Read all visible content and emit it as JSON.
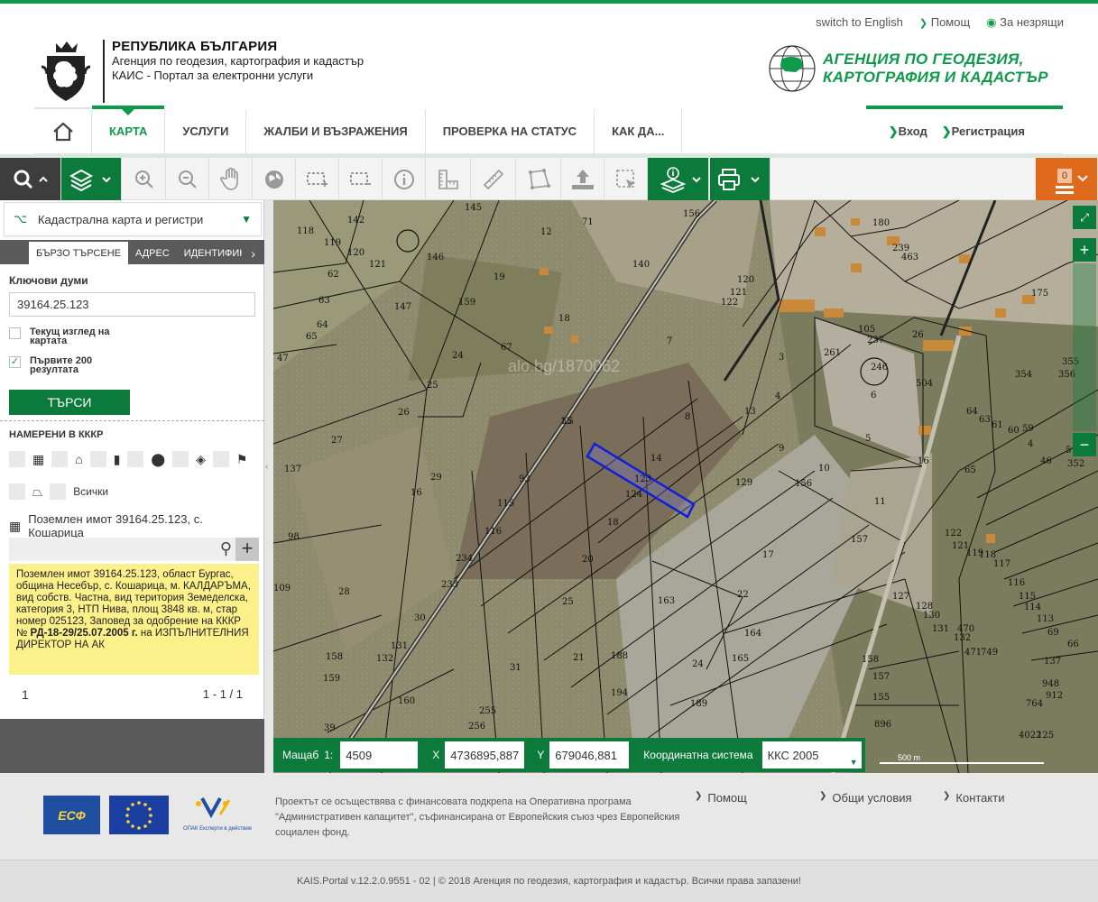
{
  "header": {
    "links": [
      "switch to English",
      "Помощ",
      "За незрящи"
    ],
    "org_line1": "РЕПУБЛИКА БЪЛГАРИЯ",
    "org_line2": "Агенция по геодезия, картография и кадастър",
    "org_line3": "КАИС - Портал за електронни услуги",
    "agency_line1": "АГЕНЦИЯ ПО ГЕОДЕЗИЯ,",
    "agency_line2": "КАРТОГРАФИЯ И КАДАСТЪР"
  },
  "nav": {
    "items": [
      "КАРТА",
      "УСЛУГИ",
      "ЖАЛБИ И ВЪЗРАЖЕНИЯ",
      "ПРОВЕРКА НА СТАТУС",
      "КАК ДА..."
    ],
    "active": "КАРТА",
    "login": "Вход",
    "register": "Регистрация"
  },
  "toolbar": {
    "cart_count": "0",
    "accent": "#0c7a3b",
    "orange": "#e06a1b"
  },
  "sidebar": {
    "layer": "Кадастрална карта и регистри",
    "tabs": [
      "БЪРЗО ТЪРСЕНЕ",
      "АДРЕС",
      "ИДЕНТИФИКА"
    ],
    "keywords_label": "Ключови думи",
    "keywords_value": "39164.25.123",
    "chk_current_view": "Текущ изглед на картата",
    "chk_first_200": "Първите 200 резултата",
    "chk_first_200_checked": "✓",
    "search_button": "ТЪРСИ",
    "found_label": "НАМЕРЕНИ В КККР",
    "filter_all": "Всички",
    "result_title": "Поземлен имот 39164.25.123, с. Кошарица",
    "info_text": "Поземлен имот 39164.25.123, област Бургас, община Несебър, с. Кошарица, м. КАЛДАРЪМА, вид собств. Частна, вид територия Земеделска, категория 3, НТП Нива, площ 3848 кв. м, стар номер 025123, Заповед за одобрение на КККР №",
    "info_bold": "РД-18-29/25.07.2005 г.",
    "info_tail": " на ИЗПЪЛНИТЕЛНИЯ ДИРЕКТОР НА АК",
    "page_current": "1",
    "page_range": "1 - 1 / 1"
  },
  "map": {
    "watermark": "alo.bg/1870062",
    "scale_label": "Мащаб",
    "scale_prefix": "1:",
    "scale_value": "4509",
    "x_label": "X",
    "x_value": "4736895,887",
    "y_label": "Y",
    "y_value": "679046,881",
    "crs_label": "Координатна система",
    "crs_value": "ККС 2005",
    "scalebar_label": "500 m",
    "parcel_labels": [
      "142",
      "118",
      "119",
      "120",
      "121",
      "62",
      "63",
      "64",
      "65",
      "147",
      "47",
      "27",
      "137",
      "98",
      "109",
      "28",
      "158",
      "159",
      "39",
      "145",
      "12",
      "71",
      "146",
      "19",
      "159",
      "18",
      "140",
      "156",
      "15",
      "67",
      "24",
      "25",
      "26",
      "29",
      "16",
      "30",
      "131",
      "132",
      "160",
      "93",
      "115",
      "116",
      "234",
      "233",
      "31",
      "255",
      "256",
      "15",
      "14",
      "123",
      "124",
      "18",
      "20",
      "25",
      "21",
      "188",
      "194",
      "8",
      "7",
      "129",
      "17",
      "163",
      "22",
      "164",
      "165",
      "24",
      "189",
      "121",
      "120",
      "122",
      "3",
      "4",
      "9",
      "10",
      "11",
      "156",
      "157",
      "6",
      "5",
      "16",
      "13",
      "158",
      "157",
      "155",
      "896",
      "4022",
      "125",
      "127",
      "128",
      "130",
      "131",
      "132",
      "470",
      "471",
      "749",
      "137",
      "764",
      "948",
      "912",
      "122",
      "121",
      "119",
      "118",
      "117",
      "116",
      "115",
      "114",
      "113",
      "69",
      "66",
      "65",
      "64",
      "63",
      "61",
      "60",
      "59",
      "4",
      "46",
      "5",
      "352",
      "354",
      "356",
      "355",
      "105",
      "237",
      "504",
      "26",
      "261",
      "246",
      "239",
      "463",
      "180",
      "175"
    ]
  },
  "footer": {
    "funding_text": "Проектът се осъществява с финансовата подкрепа на Оперативна програма \"Административен капацитет\", съфинансирана от Европейския съюз чрез Европейския социален фонд.",
    "links": [
      "Помощ",
      "Общи условия",
      "Контакти"
    ],
    "esf_label": "ЕСФ",
    "opak_caption": "ОПАК Експерти в действие",
    "copyright": "KAIS.Portal v.12.2.0.9551 - 02  |  © 2018 Агенция по геодезия, картография и кадастър. Всички права запазени!"
  }
}
